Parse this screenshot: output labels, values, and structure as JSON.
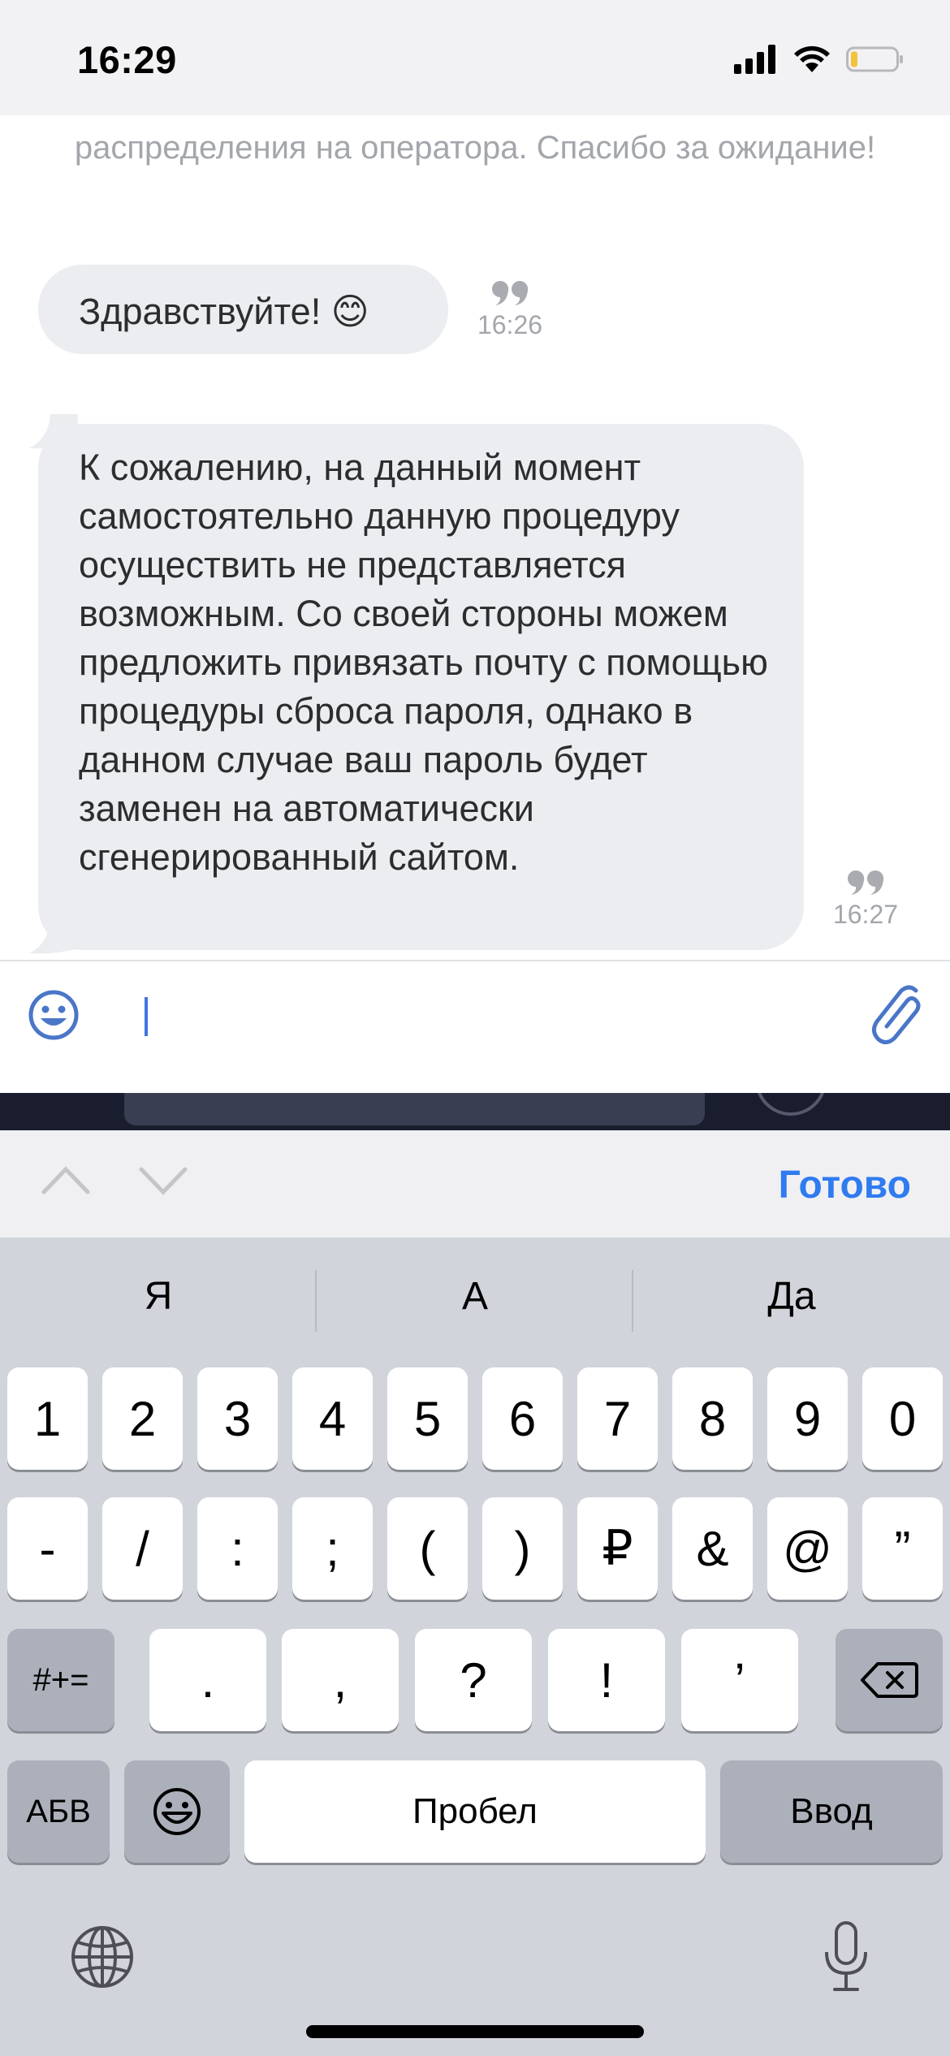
{
  "status_bar": {
    "time": "16:29"
  },
  "chat": {
    "system_message": "распределения на оператора. Спасибо за ожидание!",
    "messages": [
      {
        "text": "Здравствуйте! 😊",
        "time": "16:26"
      },
      {
        "text": "К сожалению, на данный момент самостоятельно данную процедуру осуществить не представляется возможным. Со своей стороны можем предложить привязать почту с помощью процедуры сброса пароля, однако в данном случае ваш пароль будет заменен на автоматически сгенерированный сайтом.",
        "time": "16:27"
      }
    ]
  },
  "input": {
    "value": ""
  },
  "accessory": {
    "done_label": "Готово"
  },
  "keyboard": {
    "suggestions": [
      "Я",
      "А",
      "Да"
    ],
    "row1": [
      "1",
      "2",
      "3",
      "4",
      "5",
      "6",
      "7",
      "8",
      "9",
      "0"
    ],
    "row2": [
      "-",
      "/",
      ":",
      ";",
      "(",
      ")",
      "₽",
      "&",
      "@",
      "”"
    ],
    "row3": [
      ".",
      ",",
      "?",
      "!",
      "’"
    ],
    "symbols_key": "#+=",
    "abc_key": "АБВ",
    "space_key": "Пробел",
    "return_key": "Ввод"
  },
  "colors": {
    "accent": "#2f7bf0",
    "bubble": "#ebedf1",
    "keyboard_bg": "#d1d4da"
  }
}
